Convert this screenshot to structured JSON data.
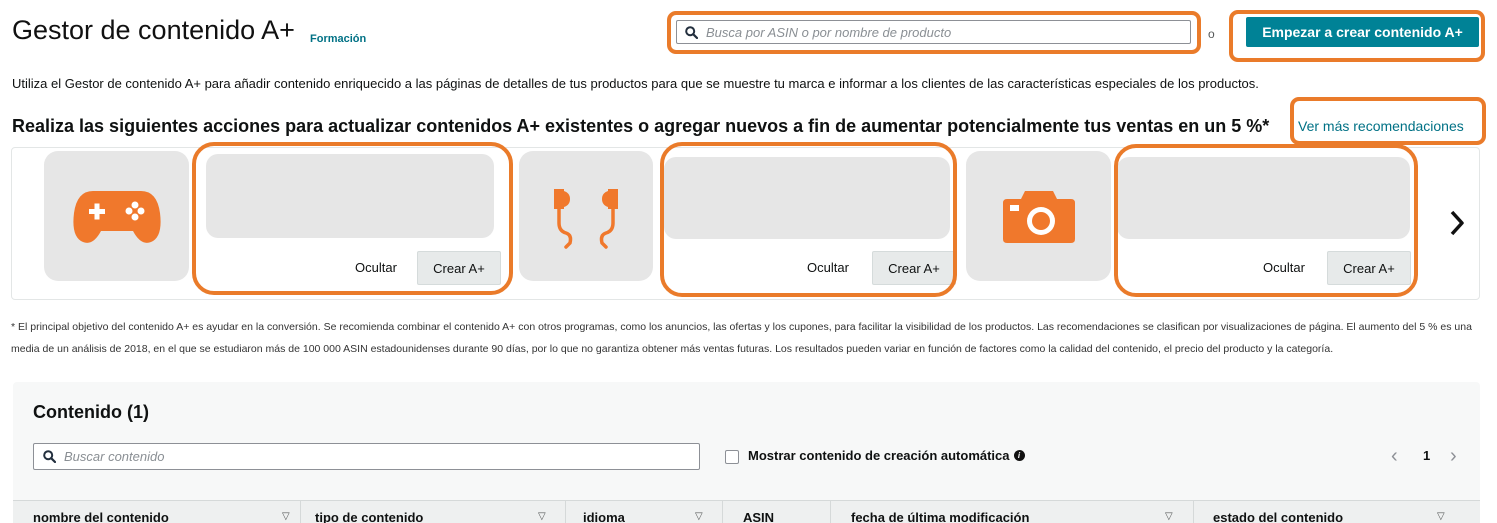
{
  "header": {
    "title": "Gestor de contenido A+",
    "training_link": "Formación",
    "search_placeholder": "Busca por ASIN o por nombre de producto",
    "or_text": "o",
    "cta_label": "Empezar a crear contenido A+"
  },
  "intro_text": "Utiliza el Gestor de contenido A+ para añadir contenido enriquecido a las páginas de detalles de tus productos para que se muestre tu marca e informar a los clientes de las características especiales de los productos.",
  "recommendations": {
    "heading": "Realiza las siguientes acciones para actualizar contenidos A+ existentes o agregar nuevos a fin de aumentar potencialmente tus ventas en un 5 %*",
    "more_link": "Ver más recomendaciones",
    "hide_label": "Ocultar",
    "create_label": "Crear A+",
    "cards": [
      {
        "icon": "gamepad-icon"
      },
      {
        "icon": "earbuds-icon"
      },
      {
        "icon": "camera-icon"
      }
    ],
    "next_icon": "chevron-right-icon"
  },
  "footnote": "* El principal objetivo del contenido A+ es ayudar en la conversión. Se recomienda combinar el contenido A+ con otros programas, como los anuncios, las ofertas y los cupones, para facilitar la visibilidad de los productos. Las recomendaciones se clasifican por visualizaciones de página. El aumento del 5 % es una media de un análisis de 2018, en el que se estudiaron más de 100 000 ASIN estadounidenses durante 90 días, por lo que no garantiza obtener más ventas futuras. Los resultados pueden variar en función de factores como la calidad del contenido, el precio del producto y la categoría.",
  "content": {
    "title": "Contenido (1)",
    "search_placeholder": "Buscar contenido",
    "auto_created_label": "Mostrar contenido de creación automática",
    "page": "1",
    "columns": [
      {
        "label": "nombre del contenido",
        "sortable": true
      },
      {
        "label": "tipo de contenido",
        "sortable": true
      },
      {
        "label": "idioma",
        "sortable": true
      },
      {
        "label": "ASIN",
        "sortable": false
      },
      {
        "label": "fecha de última modificación",
        "sortable": true
      },
      {
        "label": "estado del contenido",
        "sortable": true
      }
    ]
  },
  "colors": {
    "accent": "#008296",
    "link": "#007185",
    "highlight": "#ea7b2a",
    "icon": "#f0782c"
  }
}
